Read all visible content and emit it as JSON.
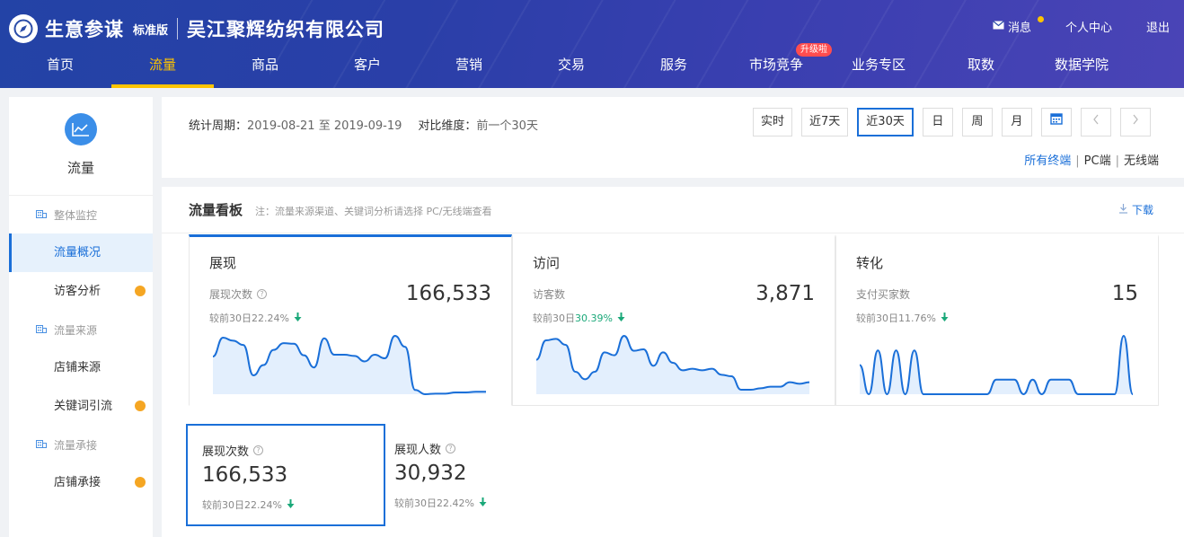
{
  "header": {
    "brand_name": "生意参谋",
    "edition": "标准版",
    "company": "吴江聚辉纺织有限公司",
    "messages": "消息",
    "user_center": "个人中心",
    "logout": "退出"
  },
  "nav": {
    "items": [
      {
        "label": "首页"
      },
      {
        "label": "流量",
        "active": true
      },
      {
        "label": "商品"
      },
      {
        "label": "客户"
      },
      {
        "label": "营销"
      },
      {
        "label": "交易"
      },
      {
        "label": "服务"
      },
      {
        "label": "市场竞争",
        "badge": "升级啦"
      },
      {
        "label": "业务专区"
      },
      {
        "label": "取数"
      },
      {
        "label": "数据学院"
      }
    ]
  },
  "sidebar": {
    "title": "流量",
    "groups": [
      {
        "label": "整体监控",
        "items": [
          {
            "label": "流量概况",
            "active": true
          },
          {
            "label": "访客分析",
            "dot": true
          }
        ]
      },
      {
        "label": "流量来源",
        "items": [
          {
            "label": "店铺来源"
          },
          {
            "label": "关键词引流",
            "dot": true
          }
        ]
      },
      {
        "label": "流量承接",
        "items": [
          {
            "label": "店铺承接",
            "dot": true
          }
        ]
      }
    ]
  },
  "period": {
    "period_label": "统计周期：",
    "period_value": "2019-08-21 至 2019-09-19",
    "compare_label": "对比维度：",
    "compare_value": "前一个30天",
    "buttons": [
      "实时",
      "近7天",
      "近30天",
      "日",
      "周",
      "月"
    ],
    "active_button": "近30天",
    "terminals": [
      "所有终端",
      "PC端",
      "无线端"
    ]
  },
  "board": {
    "title": "流量看板",
    "note": "注：流量来源渠道、关键词分析请选择 PC/无线端查看",
    "download": "下载",
    "cards": [
      {
        "title": "展现",
        "metric": "展现次数",
        "value": "166,533",
        "compare_prefix": "较前30日",
        "compare_pct": "22.24%",
        "highlight": false,
        "active": true
      },
      {
        "title": "访问",
        "metric": "访客数",
        "value": "3,871",
        "compare_prefix": "较前30日",
        "compare_pct": "30.39%",
        "highlight": true,
        "active": false
      },
      {
        "title": "转化",
        "metric": "支付买家数",
        "value": "15",
        "compare_prefix": "较前30日",
        "compare_pct": "11.76%",
        "highlight": false,
        "active": false
      }
    ],
    "minis": [
      {
        "label": "展现次数",
        "value": "166,533",
        "compare": "较前30日22.24%",
        "active": true
      },
      {
        "label": "展现人数",
        "value": "30,932",
        "compare": "较前30日22.42%",
        "active": false
      }
    ]
  },
  "chart_data": [
    {
      "type": "area",
      "series": [
        {
          "values": [
            6200,
            9300,
            8800,
            8100,
            3100,
            4800,
            7300,
            8400,
            8300,
            6400,
            4400,
            9200,
            6500,
            6500,
            6300,
            5400,
            6500,
            5900,
            9600,
            7800,
            700,
            0,
            100,
            100,
            300,
            300,
            400,
            400
          ]
        }
      ]
    },
    {
      "type": "area",
      "series": [
        {
          "values": [
            230,
            360,
            370,
            330,
            150,
            100,
            150,
            280,
            260,
            390,
            290,
            300,
            190,
            280,
            210,
            160,
            170,
            160,
            170,
            130,
            120,
            30,
            30,
            40,
            50,
            50,
            80,
            70,
            80
          ]
        }
      ]
    },
    {
      "type": "area",
      "series": [
        {
          "values": [
            2,
            0,
            3,
            0,
            3,
            0,
            3,
            0,
            0,
            0,
            0,
            0,
            0,
            0,
            0,
            1,
            1,
            1,
            0,
            1,
            0,
            1,
            1,
            1,
            0,
            0,
            0,
            0,
            0,
            4,
            0
          ]
        }
      ]
    }
  ],
  "colors": {
    "accent": "#1a6fd8",
    "warning": "#f5a623",
    "up": "#1aa879",
    "nav_active": "#ffc400"
  }
}
